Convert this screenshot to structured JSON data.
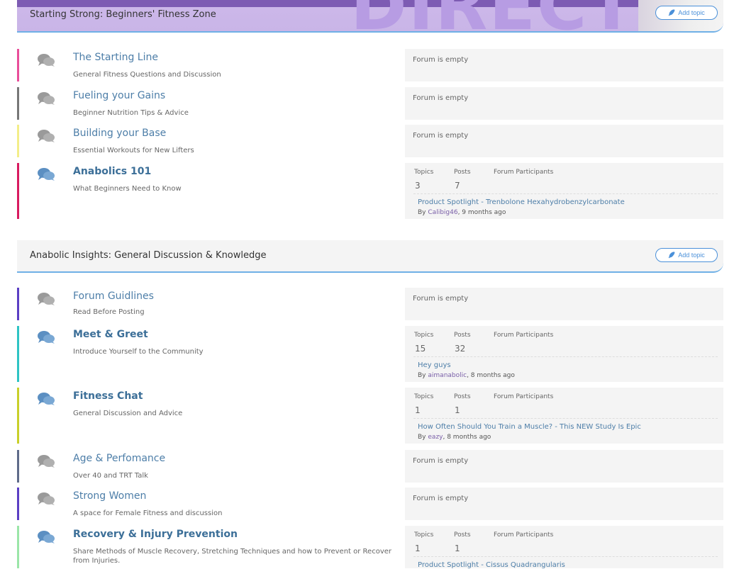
{
  "categories": [
    {
      "title": "Starting Strong: Beginners' Fitness Zone",
      "banner_text": "DIRECT",
      "add_topic": "Add topic",
      "forums": [
        {
          "title": "The Starting Line",
          "desc": "General Fitness Questions and Discussion",
          "empty": "Forum is empty",
          "stripe": "#e94e9a"
        },
        {
          "title": "Fueling your Gains",
          "desc": "Beginner Nutrition Tips & Advice",
          "empty": "Forum is empty",
          "stripe": "#777777"
        },
        {
          "title": "Building your Base",
          "desc": "Essential Workouts for New Lifters",
          "empty": "Forum is empty",
          "stripe": "#f3ee8a"
        },
        {
          "title": "Anabolics 101",
          "desc": "What Beginners Need to Know",
          "stripe": "#d81b60",
          "stats": {
            "topics_label": "Topics",
            "posts_label": "Posts",
            "participants_label": "Forum Participants",
            "topics": "3",
            "posts": "7"
          },
          "last": {
            "topic": "Product Spotlight - Trenbolone Hexahydrobenzylcarbonate",
            "by": "By",
            "author": "Calibig46",
            "time": ", 9 months ago"
          }
        }
      ]
    },
    {
      "title": "Anabolic Insights: General Discussion & Knowledge",
      "add_topic": "Add topic",
      "forums": [
        {
          "title": "Forum Guidlines",
          "desc": "Read Before Posting",
          "empty": "Forum is empty",
          "stripe": "#5b3fc4"
        },
        {
          "title": "Meet & Greet",
          "desc": "Introduce Yourself to the Community",
          "stripe": "#2ec4c4",
          "stats": {
            "topics_label": "Topics",
            "posts_label": "Posts",
            "participants_label": "Forum Participants",
            "topics": "15",
            "posts": "32"
          },
          "last": {
            "topic": "Hey guys",
            "by": "By",
            "author": "aimanabolic",
            "time": ", 8 months ago"
          }
        },
        {
          "title": "Fitness Chat",
          "desc": "General Discussion and Advice",
          "stripe": "#c9cf2a",
          "stats": {
            "topics_label": "Topics",
            "posts_label": "Posts",
            "participants_label": "Forum Participants",
            "topics": "1",
            "posts": "1"
          },
          "last": {
            "topic": "How Often Should You Train a Muscle? - This NEW Study Is Epic",
            "by": "By",
            "author": "eazy",
            "time": ", 8 months ago"
          }
        },
        {
          "title": "Age & Perfomance",
          "desc": "Over 40 and TRT Talk",
          "empty": "Forum is empty",
          "stripe": "#5f6b8a"
        },
        {
          "title": "Strong Women",
          "desc": "A space for Female Fitness and discussion",
          "empty": "Forum is empty",
          "stripe": "#5b3fc4"
        },
        {
          "title": "Recovery & Injury Prevention",
          "desc": "Share Methods of Muscle Recovery, Stretching Techniques and how to Prevent or Recover from Injuries.",
          "stripe": "#9be6a8",
          "stats": {
            "topics_label": "Topics",
            "posts_label": "Posts",
            "participants_label": "Forum Participants",
            "topics": "1",
            "posts": "1"
          },
          "last": {
            "topic": "Product Spotlight - Cissus Quadrangularis",
            "by": "",
            "author": "",
            "time": ""
          }
        }
      ]
    }
  ],
  "icons": {
    "forum": "chat-bubbles-icon",
    "add": "feather-icon"
  },
  "colors": {
    "accent": "#4a90d9",
    "link": "#4d7ea8",
    "icon_grey": "#9a9a9a",
    "icon_blue": "#5b8fc2"
  }
}
